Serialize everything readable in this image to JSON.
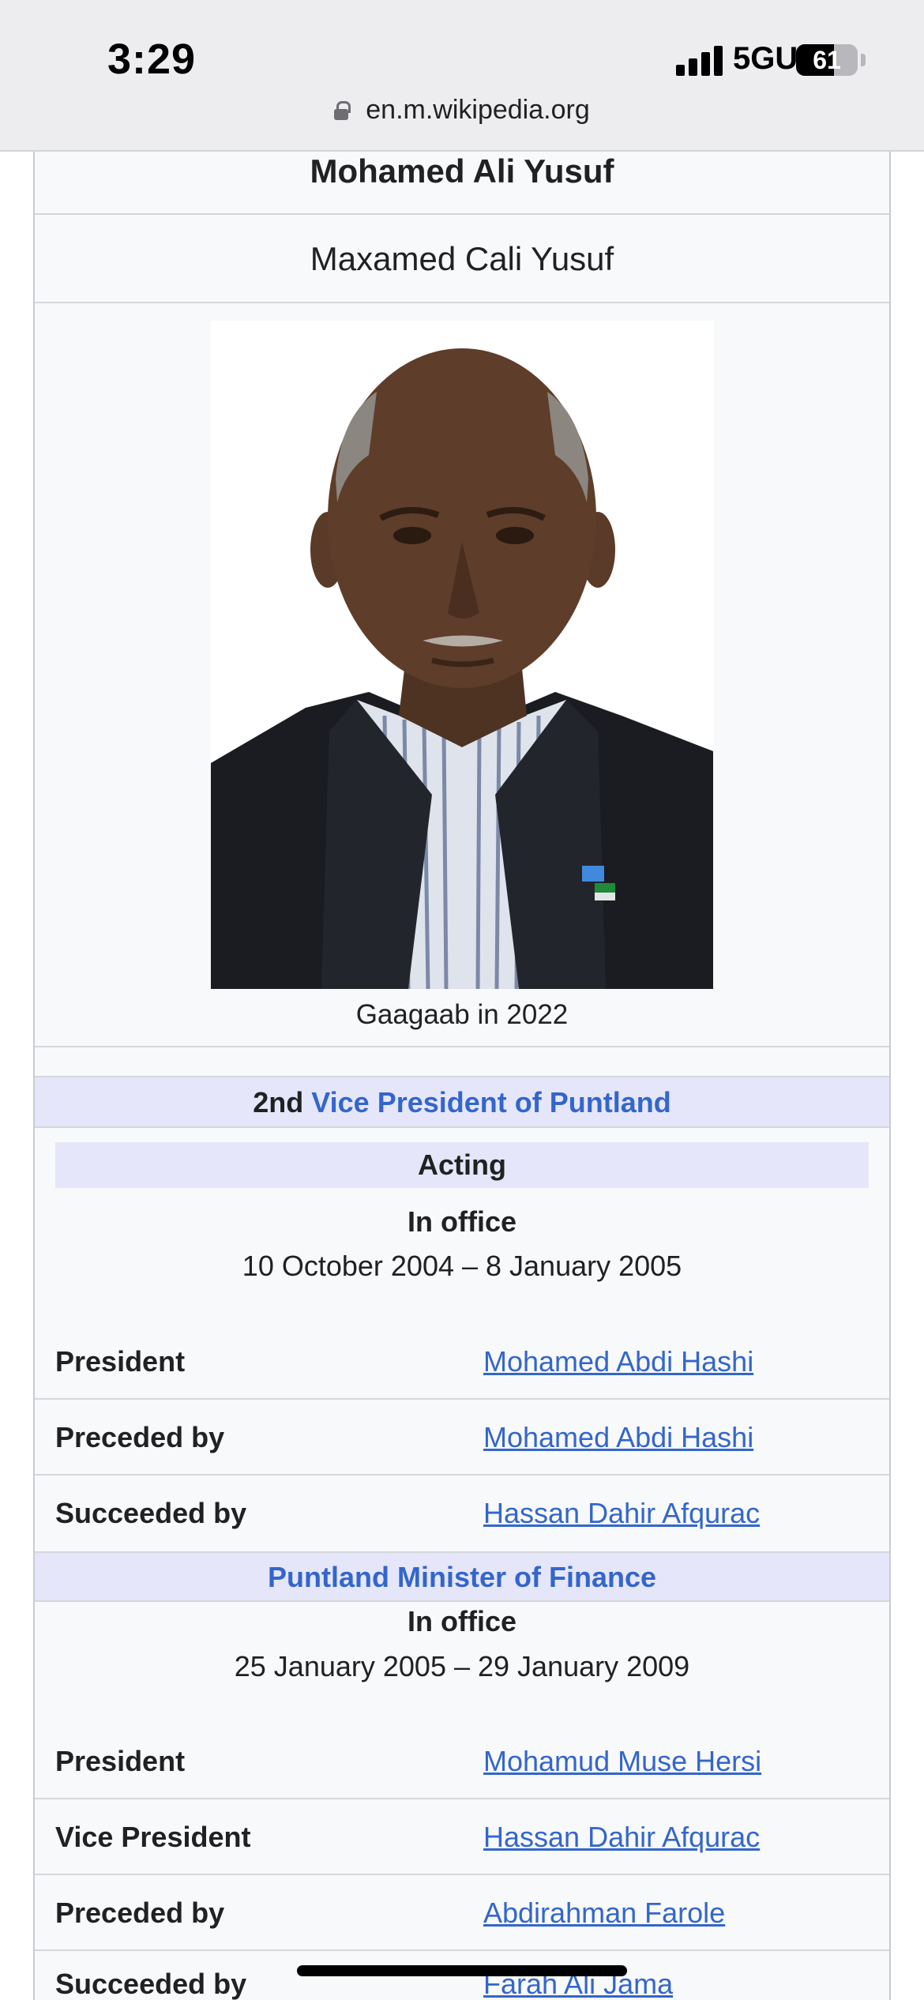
{
  "status_bar": {
    "time": "3:29",
    "network": "5GUC",
    "battery_level": "61"
  },
  "browser": {
    "url": "en.m.wikipedia.org"
  },
  "infobox": {
    "name": "Mohamed Ali Yusuf",
    "native_name": "Maxamed Cali Yusuf",
    "image_caption": "Gaagaab in 2022",
    "office1": {
      "ordinal": "2nd",
      "title": "Vice President of Puntland",
      "acting": "Acting",
      "in_office": "In office",
      "dates": "10 October 2004 – 8 January 2005",
      "rows": [
        {
          "label": "President",
          "value": "Mohamed Abdi Hashi"
        },
        {
          "label": "Preceded by",
          "value": "Mohamed Abdi Hashi"
        },
        {
          "label": "Succeeded by",
          "value": "Hassan Dahir Afqurac"
        }
      ]
    },
    "office2": {
      "title": "Puntland Minister of Finance",
      "in_office": "In office",
      "dates": "25 January 2005 – 29 January 2009",
      "rows": [
        {
          "label": "President",
          "value": "Mohamud Muse Hersi"
        },
        {
          "label": "Vice President",
          "value": "Hassan Dahir Afqurac"
        },
        {
          "label": "Preceded by",
          "value": "Abdirahman Farole"
        },
        {
          "label": "Succeeded by",
          "value": "Farah Ali Jama"
        }
      ]
    }
  },
  "colors": {
    "link": "#3366cc",
    "header_bg": "#e6e6fa",
    "infobox_bg": "#f8f9fa"
  }
}
